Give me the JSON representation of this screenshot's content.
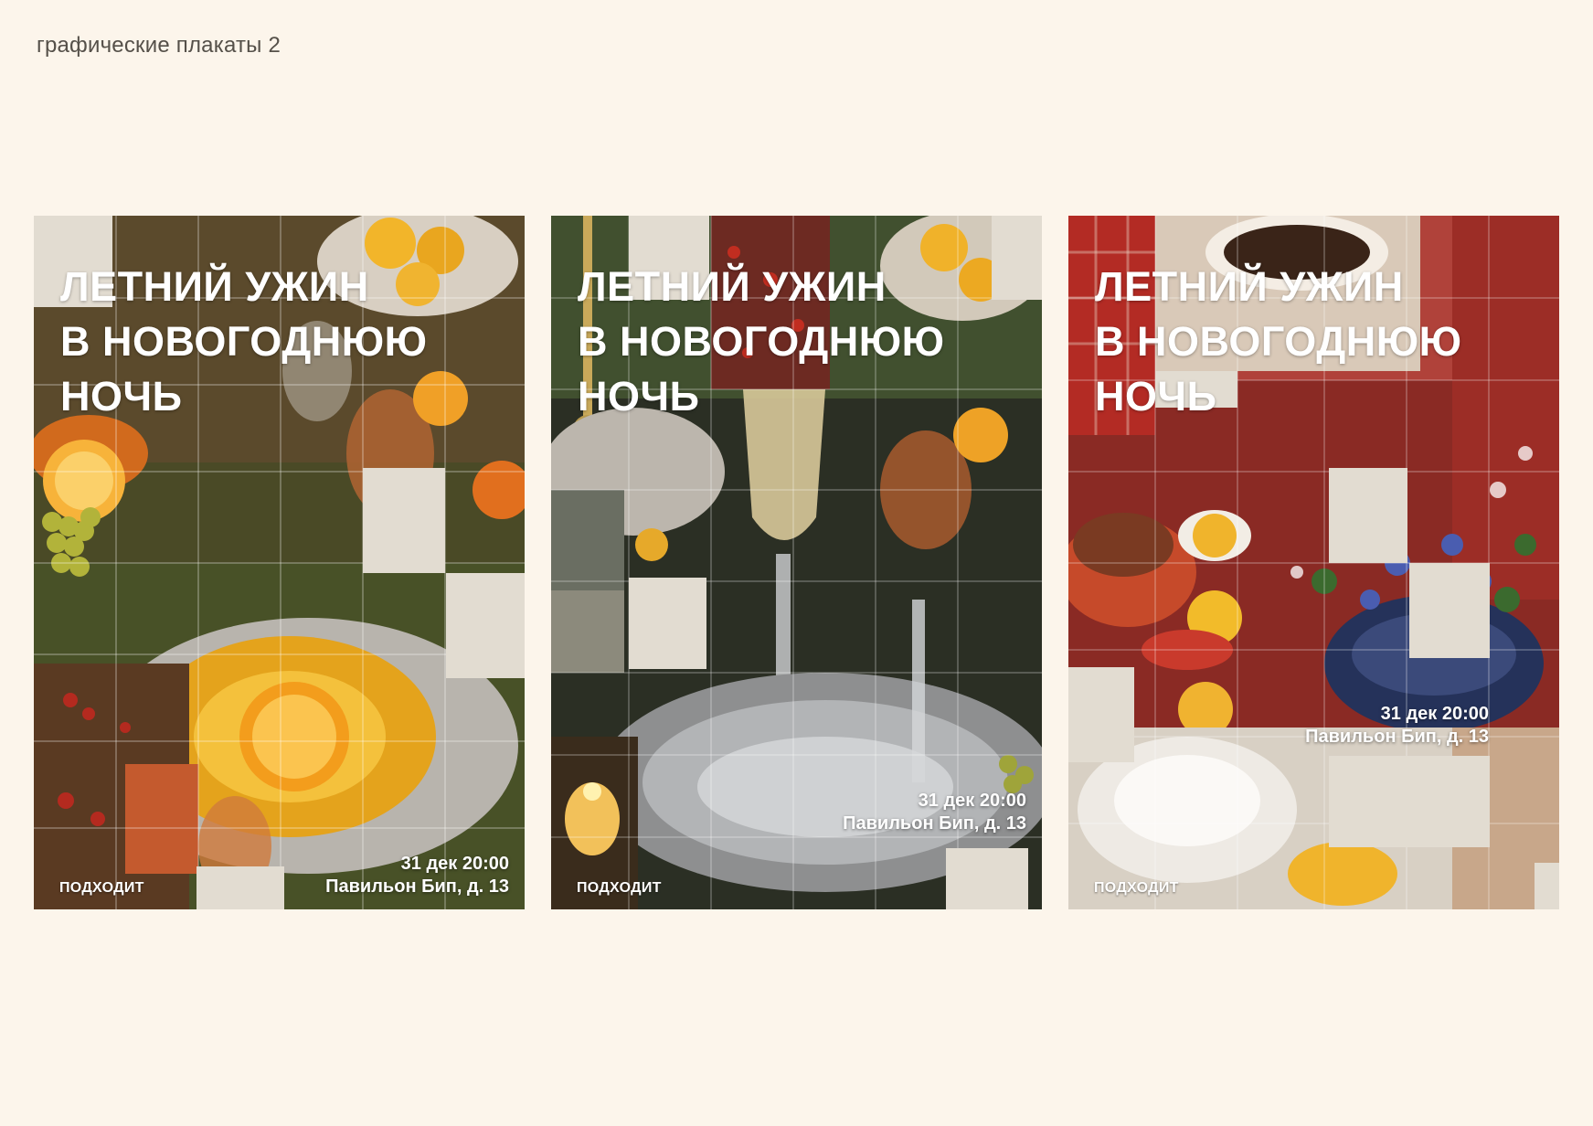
{
  "page": {
    "caption": "графические плакаты 2",
    "background_color": "#fcf5eb"
  },
  "posters": [
    {
      "title_lines": [
        "ЛЕТНИЙ УЖИН",
        "В НОВОГОДНЮЮ",
        "НОЧЬ"
      ],
      "date": "31 дек 20:00",
      "venue": "Павильон Бип, д. 13",
      "logo": "ПОДХОДИТ"
    },
    {
      "title_lines": [
        "ЛЕТНИЙ УЖИН",
        "В НОВОГОДНЮЮ",
        "НОЧЬ"
      ],
      "date": "31 дек 20:00",
      "venue": "Павильон Бип, д. 13",
      "logo": "ПОДХОДИТ"
    },
    {
      "title_lines": [
        "ЛЕТНИЙ УЖИН",
        "В НОВОГОДНЮЮ",
        "НОЧЬ"
      ],
      "date": "31 дек 20:00",
      "venue": "Павильон Бип, д. 13",
      "logo": "ПОДХОДИТ"
    }
  ],
  "colors": {
    "placeholder_block": "#e2dcd1",
    "text": "#ffffff"
  }
}
